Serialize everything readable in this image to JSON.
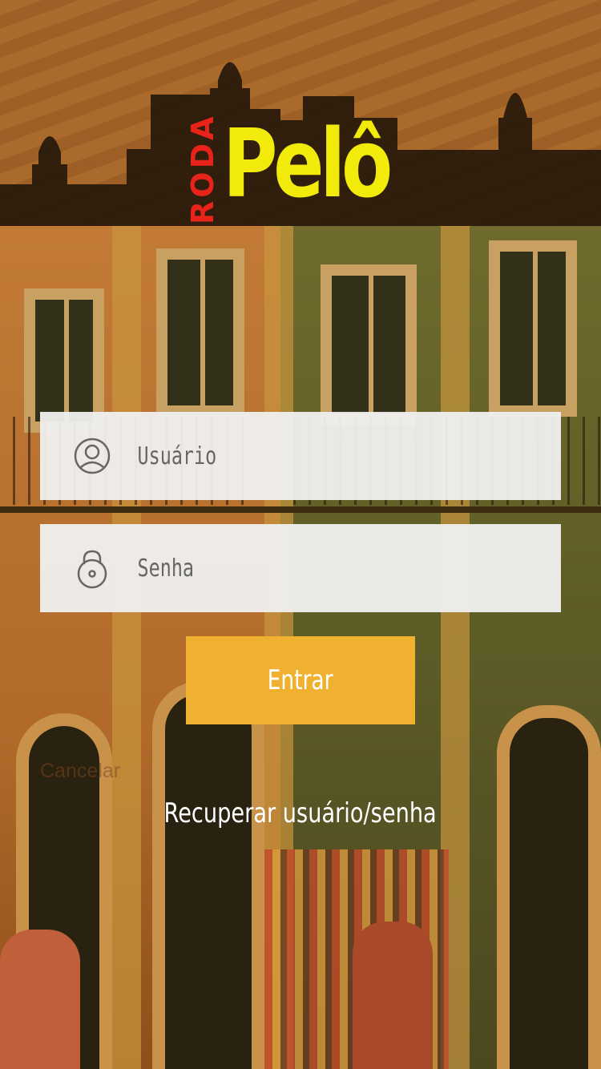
{
  "brand": {
    "logo_small": "RODA",
    "logo_big": "Pelô",
    "colors": {
      "logo_small": "#e8231a",
      "logo_big": "#f2ea0a",
      "skyline": "#2a1a0c"
    }
  },
  "login": {
    "username": {
      "placeholder": "Usuário",
      "value": "",
      "icon": "user-circle-icon"
    },
    "password": {
      "placeholder": "Senha",
      "value": "",
      "icon": "padlock-icon"
    },
    "submit_label": "Entrar",
    "cancel_label": "Cancelar",
    "recover_label": "Recuperar usuário/senha"
  },
  "colors": {
    "field_bg": "#f0f0f0",
    "button_bg": "#efb12f",
    "text_light": "#ffffff"
  }
}
